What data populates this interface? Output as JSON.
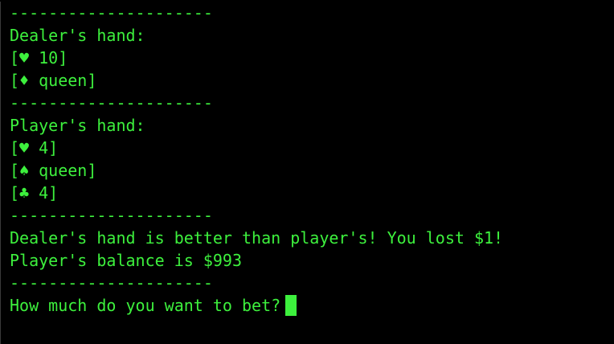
{
  "colors": {
    "background": "#000000",
    "text": "#3df03d",
    "cursor": "#3df03d"
  },
  "terminal": {
    "lines": [
      "---------------------",
      "Dealer's hand:",
      "[♥ 10]",
      "[♦ queen]",
      "---------------------",
      "Player's hand:",
      "[♥ 4]",
      "[♠ queen]",
      "[♣ 4]",
      "---------------------",
      "Dealer's hand is better than player's! You lost $1!",
      "Player's balance is $993",
      "---------------------"
    ],
    "prompt": "How much do you want to bet?"
  }
}
